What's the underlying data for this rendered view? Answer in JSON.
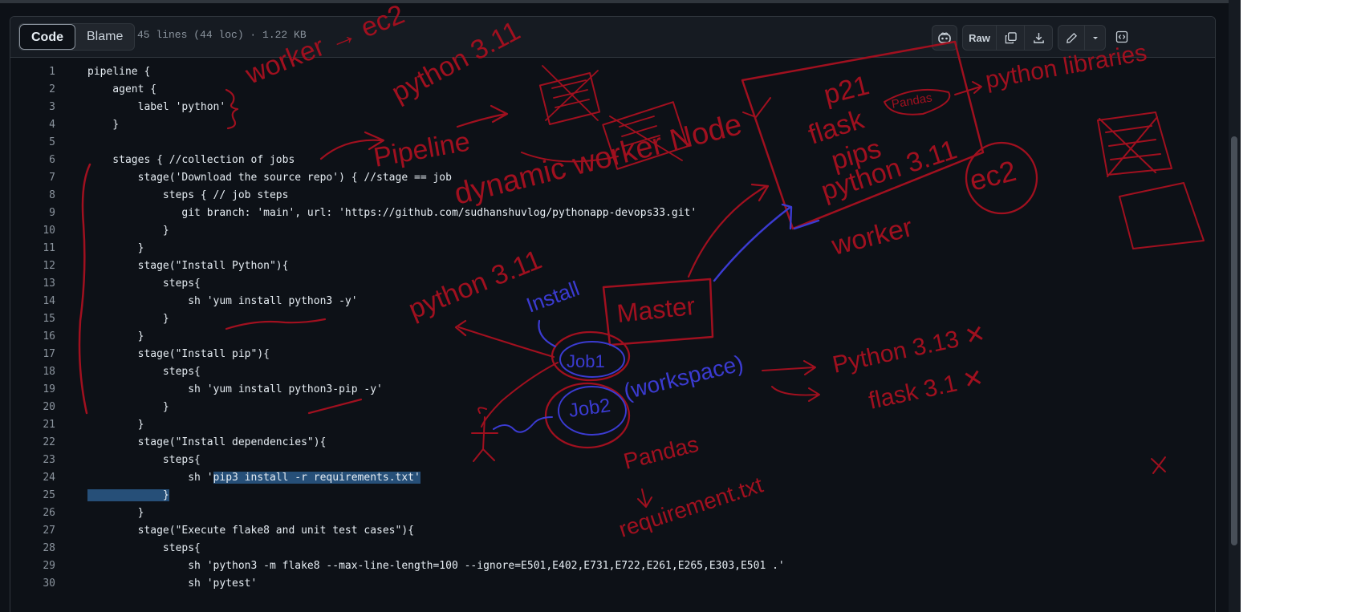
{
  "header": {
    "tabs": [
      "Code",
      "Blame"
    ],
    "file_info": "45 lines (44 loc) · 1.22 KB",
    "raw_label": "Raw",
    "icons": [
      "copilot-icon",
      "copy-icon",
      "download-icon",
      "edit-icon",
      "chevron-down-icon",
      "symbols-icon"
    ]
  },
  "code": {
    "lines": [
      {
        "n": "1",
        "text": "pipeline {"
      },
      {
        "n": "2",
        "text": "    agent {"
      },
      {
        "n": "3",
        "text": "        label 'python'"
      },
      {
        "n": "4",
        "text": "    }"
      },
      {
        "n": "5",
        "text": ""
      },
      {
        "n": "6",
        "text": "    stages { //collection of jobs"
      },
      {
        "n": "7",
        "text": "        stage('Download the source repo') { //stage == job"
      },
      {
        "n": "8",
        "text": "            steps { // job steps"
      },
      {
        "n": "9",
        "text": "               git branch: 'main', url: 'https://github.com/sudhanshuvlog/pythonapp-devops33.git'"
      },
      {
        "n": "10",
        "text": "            }"
      },
      {
        "n": "11",
        "text": "        }"
      },
      {
        "n": "12",
        "text": "        stage(\"Install Python\"){"
      },
      {
        "n": "13",
        "text": "            steps{"
      },
      {
        "n": "14",
        "text": "                sh 'yum install python3 -y'"
      },
      {
        "n": "15",
        "text": "            }"
      },
      {
        "n": "16",
        "text": "        }"
      },
      {
        "n": "17",
        "text": "        stage(\"Install pip\"){"
      },
      {
        "n": "18",
        "text": "            steps{"
      },
      {
        "n": "19",
        "text": "                sh 'yum install python3-pip -y'"
      },
      {
        "n": "20",
        "text": "            }"
      },
      {
        "n": "21",
        "text": "        }"
      },
      {
        "n": "22",
        "text": "        stage(\"Install dependencies\"){"
      },
      {
        "n": "23",
        "text": "            steps{"
      },
      {
        "n": "24",
        "text": "                sh '",
        "sel": "pip3 install -r requirements.txt'"
      },
      {
        "n": "25",
        "text": "",
        "sel_full": "            }"
      },
      {
        "n": "26",
        "text": "        }"
      },
      {
        "n": "27",
        "text": "        stage(\"Execute flake8 and unit test cases\"){"
      },
      {
        "n": "28",
        "text": "            steps{"
      },
      {
        "n": "29",
        "text": "                sh 'python3 -m flake8 --max-line-length=100 --ignore=E501,E402,E731,E722,E261,E265,E303,E501 .'"
      },
      {
        "n": "30",
        "text": "                sh 'pytest'"
      }
    ]
  },
  "annotations": {
    "ink_red": "#a0101f",
    "ink_blue": "#3b3bd1",
    "words": {
      "worker_ec2": "worker → ec2",
      "python311_top": "python 3.11",
      "pipeline": "Pipeline",
      "dynamic": "dynamic worker Node",
      "p21": "p21",
      "flask": "flask",
      "pandas_circle": "Pandas",
      "python_libraries": "python libraries",
      "pips": "pips",
      "python311_box": "python 3.11",
      "ec2_circle": "ec2",
      "worker": "worker",
      "python311_mid": "python 3.11",
      "install": "Install",
      "master": "Master",
      "job1": "Job1",
      "job2": "Job2",
      "workspace": "(workspace)",
      "python313": "Python 3.13 ✕",
      "flask31": "flask 3.1 ✕",
      "pandas": "Pandas",
      "requirements": "requirement.txt",
      "x_mark": "✕"
    }
  }
}
